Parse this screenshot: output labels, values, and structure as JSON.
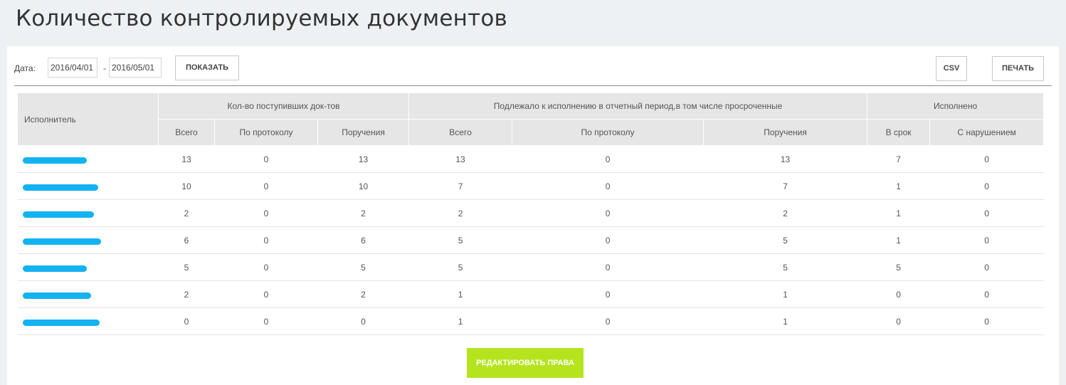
{
  "page": {
    "title": "Количество контролируемых документов"
  },
  "filter": {
    "date_label": "Дата:",
    "date_from": "2016/04/01",
    "separator": "-",
    "date_to": "2016/05/01",
    "show_label": "ПОКАЗАТЬ"
  },
  "actions": {
    "csv_label": "CSV",
    "print_label": "ПЕЧАТЬ",
    "edit_rights_label": "РЕДАКТИРОВАТЬ ПРАВА"
  },
  "colors": {
    "accent_button": "#b5e41f",
    "header_bg": "#e6e6e6",
    "redaction": "#13b2f1"
  },
  "table": {
    "executor_header": "Исполнитель",
    "groups": [
      {
        "label": "Кол-во поступивших док-тов"
      },
      {
        "label": "Подлежало к исполнению в отчетный период,в том числе просроченные"
      },
      {
        "label": "Исполнено"
      }
    ],
    "subheaders": [
      "Всего",
      "По протоколу",
      "Поручения",
      "Всего",
      "По протоколу",
      "Поручения",
      "В срок",
      "С нарушением"
    ],
    "rows": [
      {
        "name": "",
        "values": [
          "13",
          "0",
          "13",
          "13",
          "0",
          "13",
          "7",
          "0"
        ]
      },
      {
        "name": "",
        "values": [
          "10",
          "0",
          "10",
          "7",
          "0",
          "7",
          "1",
          "0"
        ]
      },
      {
        "name": "",
        "values": [
          "2",
          "0",
          "2",
          "2",
          "0",
          "2",
          "1",
          "0"
        ]
      },
      {
        "name": "",
        "values": [
          "6",
          "0",
          "6",
          "5",
          "0",
          "5",
          "1",
          "0"
        ]
      },
      {
        "name": "",
        "values": [
          "5",
          "0",
          "5",
          "5",
          "0",
          "5",
          "5",
          "0"
        ]
      },
      {
        "name": "",
        "values": [
          "2",
          "0",
          "2",
          "1",
          "0",
          "1",
          "0",
          "0"
        ]
      },
      {
        "name": "",
        "values": [
          "0",
          "0",
          "0",
          "1",
          "0",
          "1",
          "0",
          "0"
        ]
      }
    ]
  }
}
